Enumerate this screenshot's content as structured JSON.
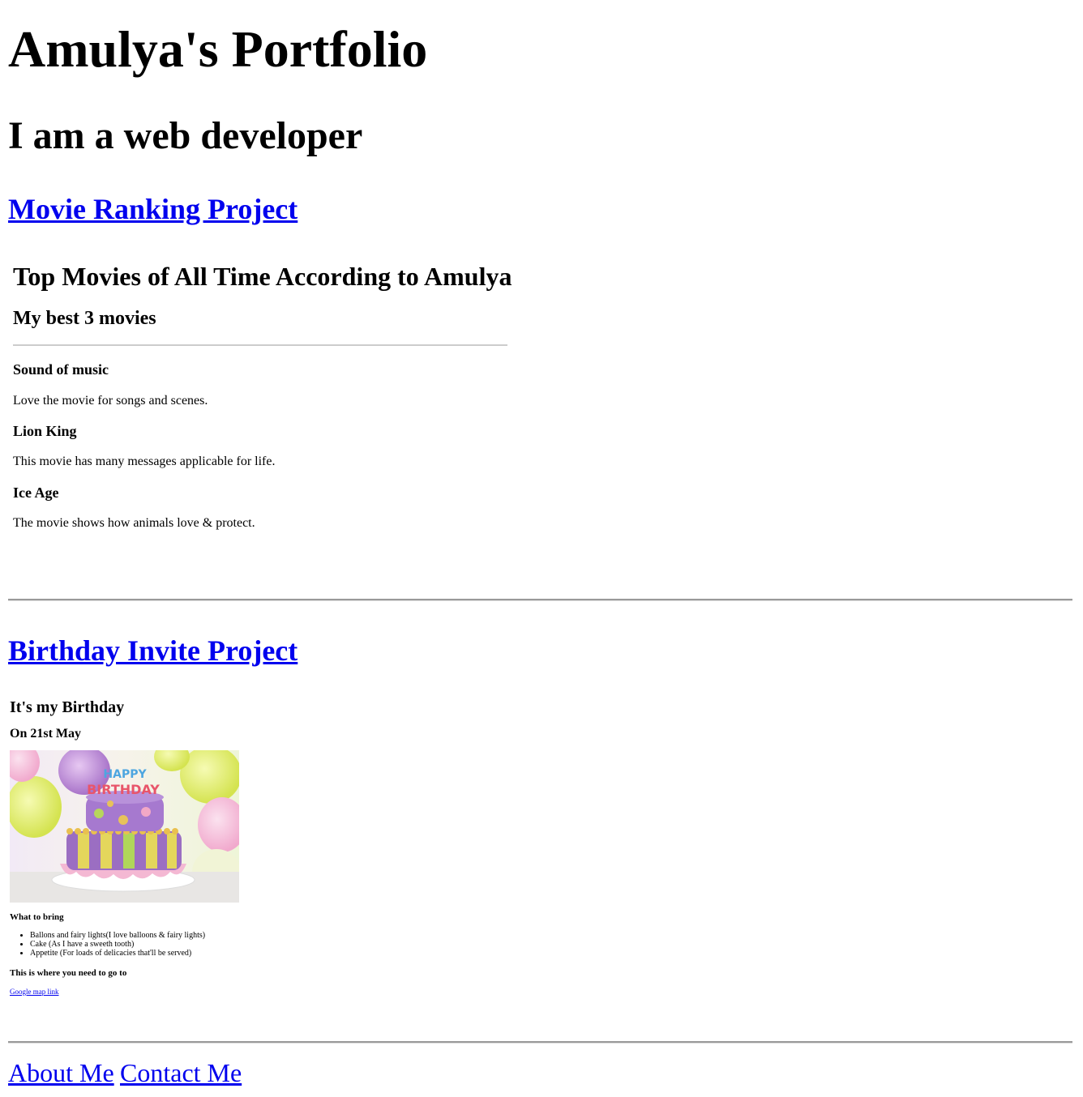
{
  "header": {
    "title": "Amulya's Portfolio",
    "subtitle": "I am a web developer"
  },
  "projects": {
    "movie_link": "Movie Ranking Project",
    "birthday_link": "Birthday Invite Project"
  },
  "movie_page": {
    "title": "Top Movies of All Time According to Amulya",
    "subtitle": "My best 3 movies",
    "movies": [
      {
        "name": "Sound of music",
        "description": "Love the movie for songs and scenes."
      },
      {
        "name": "Lion King",
        "description": "This movie has many messages applicable for life."
      },
      {
        "name": "Ice Age",
        "description": "The movie shows how animals love & protect."
      }
    ]
  },
  "birthday_page": {
    "heading": "It's my Birthday",
    "date": "On 21st May",
    "image_icon": "birthday-cake-image",
    "cake_text_top": "HAPPY",
    "cake_text_bottom": "BIRTHDAY",
    "bring_heading": "What to bring",
    "bring_items": [
      "Ballons and fairy lights(I love balloons & fairy lights)",
      "Cake (As I have a sweeth tooth)",
      "Appetite (For loads of delicacies that'll be served)"
    ],
    "where_heading": "This is where you need to go to",
    "map_link": "Google map link"
  },
  "footer": {
    "about": "About Me",
    "contact": "Contact Me"
  },
  "colors": {
    "link": "#0000ee",
    "rule": "#9a9a9a"
  }
}
